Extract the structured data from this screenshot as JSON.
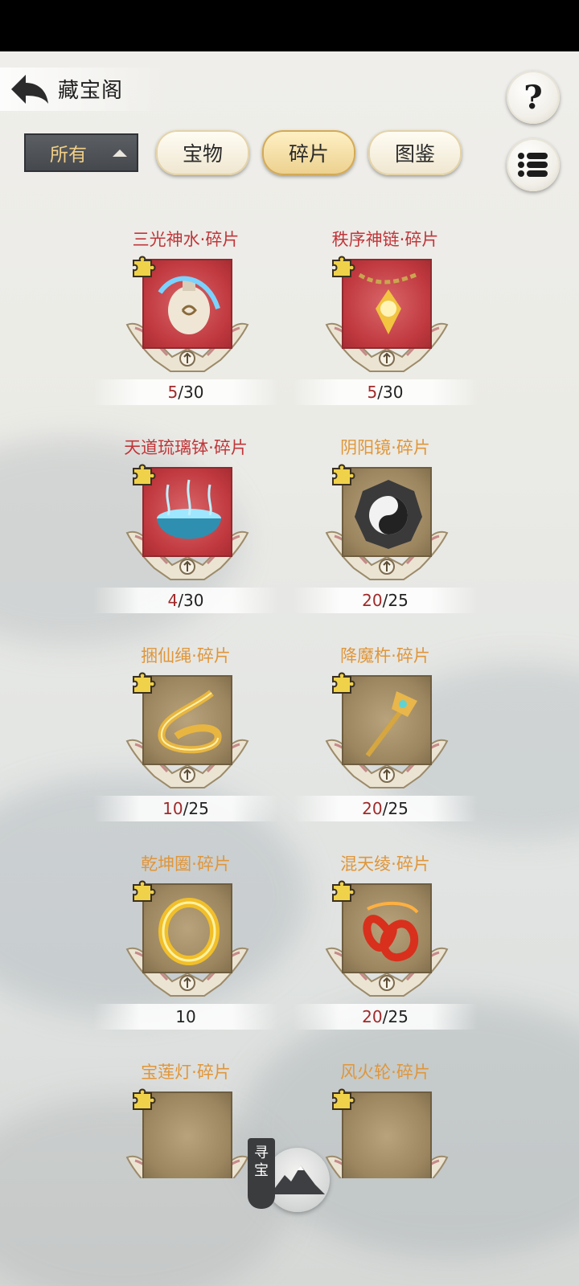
{
  "header": {
    "title": "藏宝阁",
    "help_label": "?"
  },
  "filter": {
    "selected": "所有"
  },
  "tabs": [
    {
      "label": "宝物",
      "active": false
    },
    {
      "label": "碎片",
      "active": true
    },
    {
      "label": "图鉴",
      "active": false
    }
  ],
  "items": [
    {
      "name": "三光神水·碎片",
      "name_color": "#c0363a",
      "frame": "red",
      "have": "5",
      "need": "/30",
      "art": "bottle-icon"
    },
    {
      "name": "秩序神链·碎片",
      "name_color": "#c0363a",
      "frame": "red",
      "have": "5",
      "need": "/30",
      "art": "chain-icon"
    },
    {
      "name": "天道琉璃钵·碎片",
      "name_color": "#c0363a",
      "frame": "red",
      "have": "4",
      "need": "/30",
      "art": "bowl-icon"
    },
    {
      "name": "阴阳镜·碎片",
      "name_color": "#e0963a",
      "frame": "gold",
      "have": "20",
      "need": "/25",
      "art": "yinyang-mirror-icon"
    },
    {
      "name": "捆仙绳·碎片",
      "name_color": "#e0963a",
      "frame": "gold",
      "have": "10",
      "need": "/25",
      "art": "rope-icon"
    },
    {
      "name": "降魔杵·碎片",
      "name_color": "#e0963a",
      "frame": "gold",
      "have": "20",
      "need": "/25",
      "art": "scepter-icon"
    },
    {
      "name": "乾坤圈·碎片",
      "name_color": "#e0963a",
      "frame": "gold",
      "have": "",
      "need": "10",
      "art": "ring-icon"
    },
    {
      "name": "混天绫·碎片",
      "name_color": "#e0963a",
      "frame": "gold",
      "have": "20",
      "need": "/25",
      "art": "ribbon-icon"
    },
    {
      "name": "宝莲灯·碎片",
      "name_color": "#e0963a",
      "frame": "gold",
      "have": "",
      "need": "",
      "art": "lotus-lamp-icon"
    },
    {
      "name": "风火轮·碎片",
      "name_color": "#e0963a",
      "frame": "gold",
      "have": "",
      "need": "",
      "art": "wheel-icon"
    }
  ],
  "hunt": {
    "label": "寻宝"
  },
  "colors": {
    "count_have": "#a02a2a",
    "tab_active": "#ecd08e",
    "filter_text": "#f2cf86"
  }
}
